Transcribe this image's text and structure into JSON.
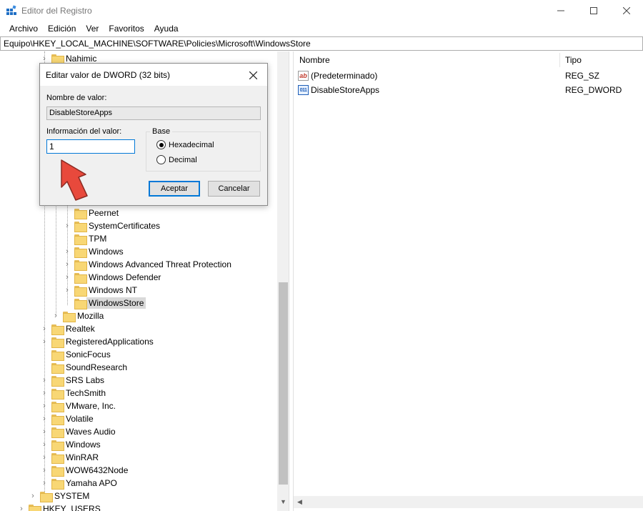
{
  "window": {
    "title": "Editor del Registro",
    "min_glyph": "—",
    "max_glyph": "☐",
    "close_glyph": "✕"
  },
  "menu": [
    "Archivo",
    "Edición",
    "Ver",
    "Favoritos",
    "Ayuda"
  ],
  "address": "Equipo\\HKEY_LOCAL_MACHINE\\SOFTWARE\\Policies\\Microsoft\\WindowsStore",
  "tree": {
    "top_item": "Nahimic",
    "policy_children": [
      "Peernet",
      "SystemCertificates",
      "TPM",
      "Windows",
      "Windows Advanced Threat Protection",
      "Windows Defender",
      "Windows NT",
      "WindowsStore"
    ],
    "selected": "WindowsStore",
    "policy_sibling": "Mozilla",
    "software_items": [
      "Realtek",
      "RegisteredApplications",
      "SonicFocus",
      "SoundResearch",
      "SRS Labs",
      "TechSmith",
      "VMware, Inc.",
      "Volatile",
      "Waves Audio",
      "Windows",
      "WinRAR",
      "WOW6432Node",
      "Yamaha APO"
    ],
    "hive_items": [
      "SYSTEM",
      "HKEY_USERS"
    ]
  },
  "values_pane": {
    "col_name": "Nombre",
    "col_type": "Tipo",
    "rows": [
      {
        "name": "(Predeterminado)",
        "type": "REG_SZ",
        "icon": "string-value-icon"
      },
      {
        "name": "DisableStoreApps",
        "type": "REG_DWORD",
        "icon": "binary-value-icon"
      }
    ]
  },
  "dialog": {
    "title": "Editar valor de DWORD (32 bits)",
    "name_label": "Nombre de valor:",
    "name_value": "DisableStoreApps",
    "data_label": "Información del valor:",
    "data_value": "1",
    "base_label": "Base",
    "radio_hex": "Hexadecimal",
    "radio_dec": "Decimal",
    "selected_base": "Hexadecimal",
    "ok_label": "Aceptar",
    "cancel_label": "Cancelar"
  },
  "colors": {
    "accent": "#0078d7",
    "folder": "#f8d775",
    "annotation_arrow": "#e8493c"
  }
}
